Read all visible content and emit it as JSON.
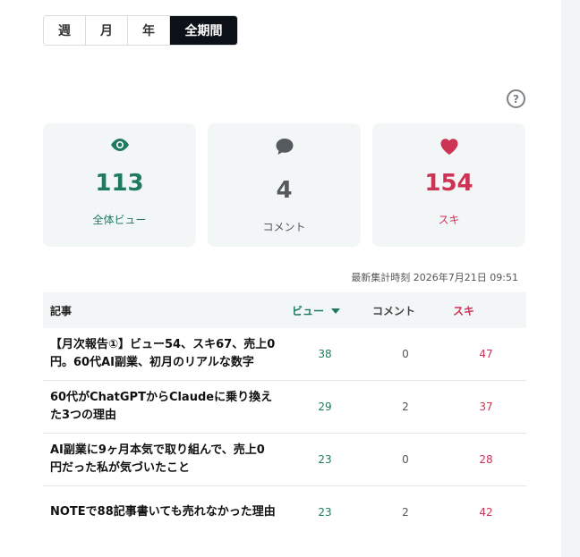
{
  "tabs": [
    {
      "label": "週",
      "active": false
    },
    {
      "label": "月",
      "active": false
    },
    {
      "label": "年",
      "active": false
    },
    {
      "label": "全期間",
      "active": true
    }
  ],
  "help_symbol": "?",
  "stats": {
    "views": {
      "value": "113",
      "label": "全体ビュー",
      "icon": "eye-icon",
      "color": "#1f7a5f"
    },
    "comments": {
      "value": "4",
      "label": "コメント",
      "icon": "comment-icon",
      "color": "#555a5e"
    },
    "likes": {
      "value": "154",
      "label": "スキ",
      "icon": "heart-icon",
      "color": "#cc3355"
    }
  },
  "timestamp": "最新集計時刻 2026年7月21日 09:51",
  "table": {
    "headers": {
      "title": "記事",
      "views": "ビュー",
      "comments": "コメント",
      "likes": "スキ"
    },
    "rows": [
      {
        "title": "【月次報告①】ビュー54、スキ67、売上0円。60代AI副業、初月のリアルな数字",
        "views": "38",
        "comments": "0",
        "likes": "47"
      },
      {
        "title": "60代がChatGPTからClaudeに乗り換えた3つの理由",
        "views": "29",
        "comments": "2",
        "likes": "37"
      },
      {
        "title": "AI副業に9ヶ月本気で取り組んで、売上0円だった私が気づいたこと",
        "views": "23",
        "comments": "0",
        "likes": "28"
      },
      {
        "title": "NOTEで88記事書いても売れなかった理由",
        "views": "23",
        "comments": "2",
        "likes": "42"
      }
    ]
  }
}
